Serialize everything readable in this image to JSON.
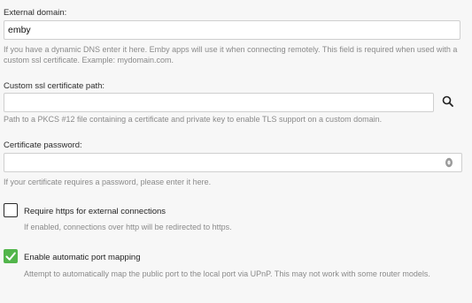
{
  "external_domain": {
    "label": "External domain:",
    "value": "emby",
    "help": "If you have a dynamic DNS enter it here. Emby apps will use it when connecting remotely. This field is required when used with a custom ssl certificate. Example: mydomain.com."
  },
  "ssl_certificate": {
    "label": "Custom ssl certificate path:",
    "value": "",
    "help": "Path to a PKCS #12 file containing a certificate and private key to enable TLS support on a custom domain.",
    "icon": "search-icon"
  },
  "certificate_password": {
    "label": "Certificate password:",
    "value": "",
    "help": "If your certificate requires a password, please enter it here.",
    "icon": "eye-icon"
  },
  "require_https": {
    "label": "Require https for external connections",
    "checked": false,
    "help": "If enabled, connections over http will be redirected to https."
  },
  "port_mapping": {
    "label": "Enable automatic port mapping",
    "checked": true,
    "help": "Attempt to automatically map the public port to the local port via UPnP. This may not work with some router models."
  },
  "colors": {
    "accent": "#52b54b",
    "background": "#f7f7f7"
  }
}
